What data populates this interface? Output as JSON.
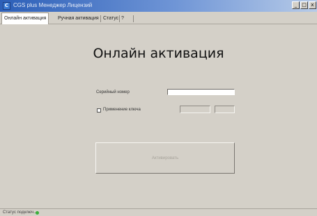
{
  "window": {
    "title": "CGS plus Менеджер Лицензий",
    "icon": "app-icon",
    "controls": [
      "_",
      "□",
      "x"
    ]
  },
  "tabs": [
    {
      "label": "Онлайн активация",
      "active": true
    },
    {
      "label": "Ручная активация",
      "active": false
    },
    {
      "label": "Статус",
      "active": false
    },
    {
      "label": "?",
      "active": false
    }
  ],
  "main": {
    "heading": "Онлайн активация",
    "serial_label": "Серийный номер",
    "serial_value": "",
    "key_label": "Применение ключа",
    "key_checked": false,
    "activate_label": "Активировать"
  },
  "status": {
    "text": "Статус подключ...",
    "indicator_color": "#3ab03a"
  }
}
